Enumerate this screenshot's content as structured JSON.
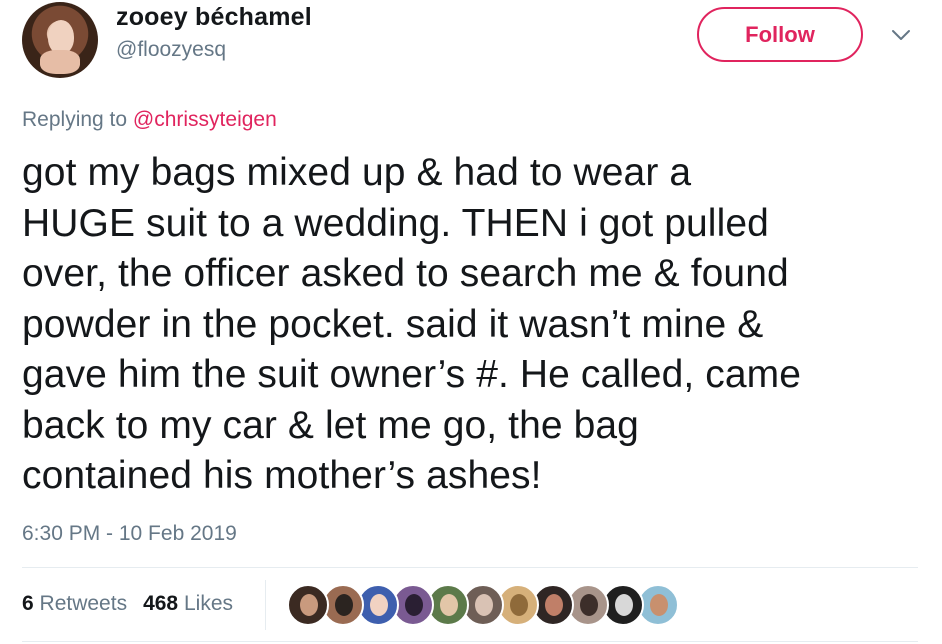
{
  "tweet": {
    "display_name": "zooey béchamel",
    "handle": "@floozyesq",
    "follow_label": "Follow",
    "replying_prefix": "Replying to",
    "replying_mention": "@chrissyteigen",
    "text": "got my bags mixed up & had to wear a\nHUGE suit to a wedding. THEN i got pulled\nover, the officer asked to search me & found\npowder in the pocket. said it wasn’t mine &\ngave him the suit owner’s #. He called, came\nback to my car & let me go, the bag\ncontained his mother’s ashes!",
    "timestamp": "6:30 PM - 10 Feb 2019",
    "retweets_count": "6",
    "retweets_label": "Retweets",
    "likes_count": "468",
    "likes_label": "Likes"
  },
  "colors": {
    "accent": "#e0245e",
    "secondary_text": "#657786",
    "primary_text": "#14171a",
    "divider": "#e6ecf0"
  },
  "icons": {
    "more": "chevron-down-icon"
  },
  "likers": [
    {
      "bg": "#3b2a22",
      "fg": "#c99a7e"
    },
    {
      "bg": "#9a6b52",
      "fg": "#2b2420"
    },
    {
      "bg": "#3e5fae",
      "fg": "#f1d2c2"
    },
    {
      "bg": "#7a5a92",
      "fg": "#2a1f33"
    },
    {
      "bg": "#5c7a4a",
      "fg": "#e2c6a8"
    },
    {
      "bg": "#6e5e56",
      "fg": "#d9c2b4"
    },
    {
      "bg": "#d6b07a",
      "fg": "#8f6a3a"
    },
    {
      "bg": "#2f2624",
      "fg": "#c07f68"
    },
    {
      "bg": "#a8948a",
      "fg": "#3c2e2a"
    },
    {
      "bg": "#1f1f1f",
      "fg": "#d8d8d8"
    },
    {
      "bg": "#8fbfd6",
      "fg": "#c8906e"
    }
  ]
}
